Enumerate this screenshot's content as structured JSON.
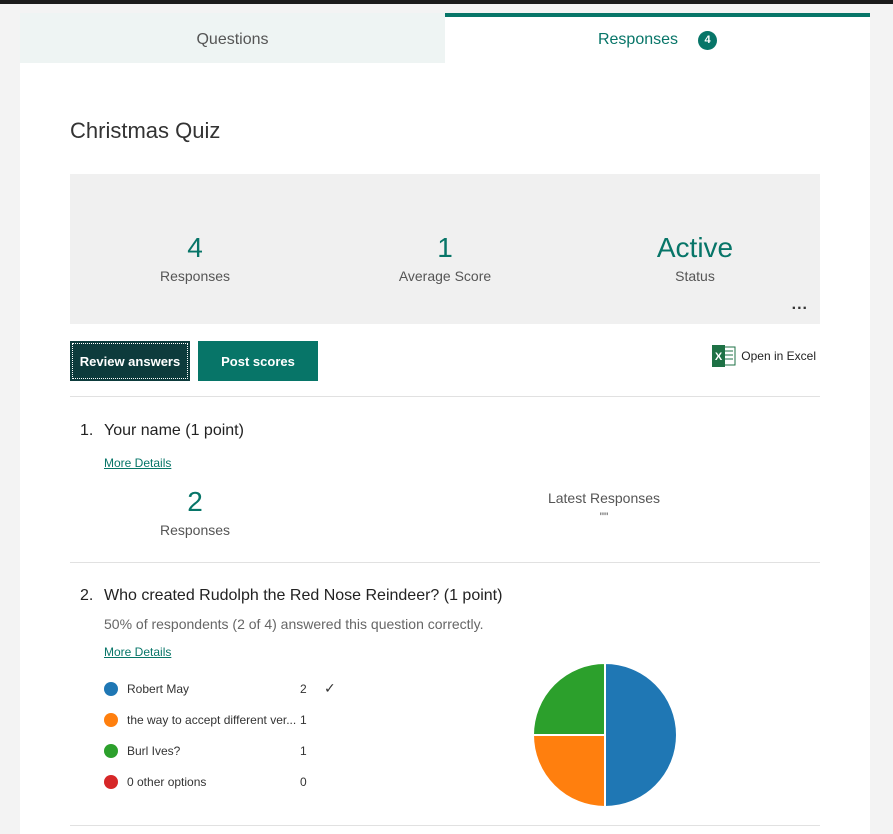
{
  "tabs": {
    "questions_label": "Questions",
    "responses_label": "Responses",
    "responses_badge": "4"
  },
  "form": {
    "title": "Christmas Quiz"
  },
  "summary": {
    "responses_value": "4",
    "responses_label": "Responses",
    "avg_score_value": "1",
    "avg_score_label": "Average Score",
    "status_value": "Active",
    "status_label": "Status",
    "more_label": "..."
  },
  "actions": {
    "review_label": "Review answers",
    "post_label": "Post scores",
    "excel_label": "Open in Excel"
  },
  "questions": [
    {
      "number": "1.",
      "text": "Your name (1 point)",
      "more_details": "More Details",
      "responses_value": "2",
      "responses_label": "Responses",
      "latest_label": "Latest Responses",
      "latest_value": "\"\""
    },
    {
      "number": "2.",
      "text": "Who created Rudolph the Red Nose Reindeer? (1 point)",
      "summary": "50% of respondents (2 of 4) answered this question correctly.",
      "more_details": "More Details",
      "options": [
        {
          "label": "Robert May",
          "count": "2",
          "color": "#1f77b4",
          "correct": true
        },
        {
          "label": "the way to accept different ver...",
          "count": "1",
          "color": "#ff7f0e",
          "correct": false
        },
        {
          "label": "Burl Ives?",
          "count": "1",
          "color": "#2ca02c",
          "correct": false
        },
        {
          "label": "0 other options",
          "count": "0",
          "color": "#d62728",
          "correct": false
        }
      ]
    }
  ],
  "colors": {
    "accent": "#077568",
    "review_button": "#0d3b3c",
    "excel_green": "#1e7145"
  },
  "icons": {
    "excel": "excel-icon",
    "checkmark": "check-icon",
    "more": "ellipsis-icon"
  }
}
